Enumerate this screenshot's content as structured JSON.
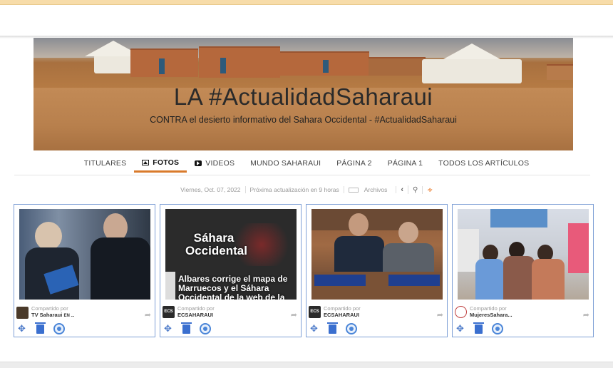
{
  "banner": {
    "title": "LA #ActualidadSaharaui",
    "subtitle": "CONTRA el desierto informativo del Sahara Occidental - #ActualidadSaharaui"
  },
  "nav": {
    "items": [
      {
        "label": "TITULARES",
        "icon": "",
        "active": false
      },
      {
        "label": "FOTOS",
        "icon": "image-icon",
        "active": true
      },
      {
        "label": "VIDEOS",
        "icon": "video-icon",
        "active": false
      },
      {
        "label": "MUNDO SAHARAUI",
        "icon": "",
        "active": false
      },
      {
        "label": "PÁGINA 2",
        "icon": "",
        "active": false
      },
      {
        "label": "PÁGINA 1",
        "icon": "",
        "active": false
      },
      {
        "label": "TODOS LOS ARTÍCULOS",
        "icon": "",
        "active": false
      }
    ]
  },
  "meta": {
    "date": "Viernes, Oct. 07, 2022",
    "next_update": "Próxima actualización en 9 horas",
    "archive": "Archivos",
    "prev_icon": "chevron-left-icon",
    "search_icon": "search-icon",
    "rss_icon": "rss-icon"
  },
  "cards": [
    {
      "shared_label": "Compartido por",
      "source": "TV Saharaui",
      "source_suffix": "EN ...",
      "logo_color": "#4a3a2a"
    },
    {
      "shared_label": "Compartido por",
      "source": "ECSAHARAUI",
      "logo_text": "ECS",
      "logo_color": "#2a2a2a",
      "image_text": {
        "heading": "Sáhara Occidental",
        "body": "Albares corrige el mapa de Marruecos y el Sáhara Occidental de la web de la"
      }
    },
    {
      "shared_label": "Compartido por",
      "source": "ECSAHARAUI",
      "logo_text": "ECS",
      "logo_color": "#2a2a2a"
    },
    {
      "shared_label": "Compartido por",
      "source": "MujeresSahara...",
      "logo_color": "#c04040"
    }
  ],
  "colors": {
    "accent": "#d97a2b",
    "card_border": "#7fa0d6",
    "icon_blue": "#3a6fcf"
  }
}
